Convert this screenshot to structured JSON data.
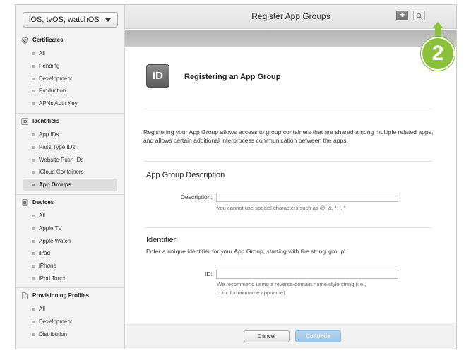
{
  "sidebar": {
    "platform": "iOS, tvOS, watchOS",
    "sections": {
      "certificates": {
        "title": "Certificates",
        "items": [
          "All",
          "Pending",
          "Development",
          "Production",
          "APNs Auth Key"
        ]
      },
      "identifiers": {
        "title": "Identifiers",
        "items": [
          "App IDs",
          "Pass Type IDs",
          "Website Push IDs",
          "iCloud Containers",
          "App Groups"
        ]
      },
      "devices": {
        "title": "Devices",
        "items": [
          "All",
          "Apple TV",
          "Apple Watch",
          "iPad",
          "iPhone",
          "iPod Touch"
        ]
      },
      "profiles": {
        "title": "Provisioning Profiles",
        "items": [
          "All",
          "Development",
          "Distribution"
        ]
      }
    },
    "active_item": "App Groups"
  },
  "header": {
    "title": "Register App Groups",
    "add_icon": "plus-icon",
    "search_icon": "search-icon"
  },
  "callout": {
    "number": "2",
    "color": "#8cc23b"
  },
  "main": {
    "icon_text": "ID",
    "heading": "Registering an App Group",
    "intro": "Registering your App Group allows access to group containers that are shared among multiple related apps, and allows certain additional interprocess communication between the apps.",
    "description_section": {
      "title": "App Group Description",
      "label": "Description:",
      "value": "",
      "hint": "You cannot use special characters such as @, &, *, ', \""
    },
    "identifier_section": {
      "title": "Identifier",
      "description": "Enter a unique identifier for your App Group, starting with the string 'group'.",
      "label": "ID:",
      "value": "",
      "hint_line1": "We recommend using a reverse-domain name style string (i.e.,",
      "hint_line2": "com.domainname.appname)."
    }
  },
  "footer": {
    "cancel": "Cancel",
    "continue": "Continue"
  }
}
